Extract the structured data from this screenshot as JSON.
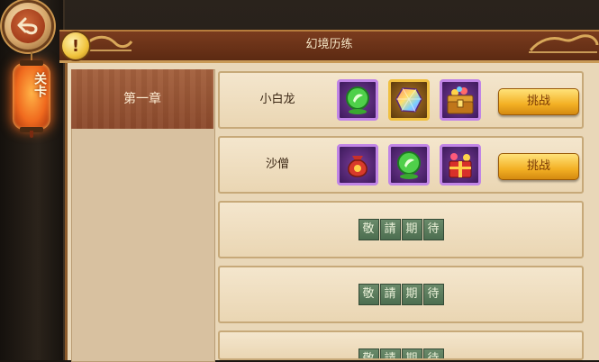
{
  "header": {
    "title": "幻境历练"
  },
  "sidebar": {
    "back_icon": "back-arrow-icon",
    "tab_label": "关卡",
    "chapters": [
      {
        "label": "第一章"
      }
    ]
  },
  "stages": [
    {
      "name": "小白龙",
      "rewards": [
        "green-orb-icon",
        "rainbow-gem-icon",
        "treasure-chest-icon"
      ],
      "button": "挑战"
    },
    {
      "name": "沙僧",
      "rewards": [
        "red-pouch-icon",
        "green-orb-icon",
        "gift-box-icon"
      ],
      "button": "挑战"
    }
  ],
  "coming_soon": {
    "label": "敬請期待",
    "chars": [
      "敬",
      "請",
      "期",
      "待"
    ]
  },
  "colors": {
    "accent": "#f3b024",
    "title_bar": "#6a3217",
    "panel": "#e9d7b8"
  }
}
